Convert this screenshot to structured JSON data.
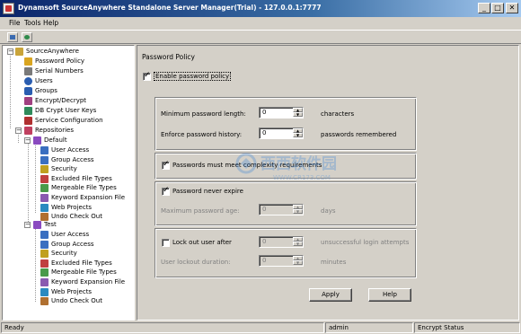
{
  "window": {
    "title": "Dynamsoft SourceAnywhere Standalone Server Manager(Trial) - 127.0.0.1:7777",
    "controls": [
      "_",
      "□",
      "✕"
    ]
  },
  "menu": [
    "File",
    "Tools",
    "Help"
  ],
  "toolbar": {
    "buttons": [
      "disk-icon",
      "globe-icon"
    ]
  },
  "tree": {
    "root": "SourceAnywhere",
    "items": {
      "password_policy": "Password Policy",
      "serial_numbers": "Serial Numbers",
      "users": "Users",
      "groups": "Groups",
      "encrypt": "Encrypt/Decrypt",
      "dbkeys": "DB Crypt User Keys",
      "service": "Service Configuration",
      "repositories": "Repositories"
    },
    "repos": [
      {
        "name": "Default",
        "children": [
          "User Access",
          "Group Access",
          "Security",
          "Excluded File Types",
          "Mergeable File Types",
          "Keyword Expansion File",
          "Web Projects",
          "Undo Check Out"
        ]
      },
      {
        "name": "Test",
        "children": [
          "User Access",
          "Group Access",
          "Security",
          "Excluded File Types",
          "Mergeable File Types",
          "Keyword Expansion File",
          "Web Projects",
          "Undo Check Out"
        ]
      }
    ]
  },
  "panel": {
    "title": "Password Policy",
    "enable_label": "Enable password policy",
    "min_length_label": "Minimum password length:",
    "min_length_value": "0",
    "min_length_unit": "characters",
    "history_label": "Enforce password history:",
    "history_value": "0",
    "history_unit": "passwords remembered",
    "complexity_label": "Passwords must meet complexity requirements",
    "expire_label": "Password never expire",
    "max_age_label": "Maximum password age:",
    "max_age_value": "0",
    "max_age_unit": "days",
    "lockout_label": "Lock out user after",
    "lockout_value": "0",
    "lockout_unit": "unsuccessful login attempts",
    "lockout_duration_label": "User lockout duration:",
    "lockout_duration_value": "0",
    "lockout_duration_unit": "minutes",
    "apply": "Apply",
    "help": "Help"
  },
  "watermark": {
    "main": "西西软件园",
    "sub": "WWW.CR173.COM"
  },
  "status": {
    "left": "Ready",
    "middle": "admin",
    "right": "Encrypt Status"
  }
}
